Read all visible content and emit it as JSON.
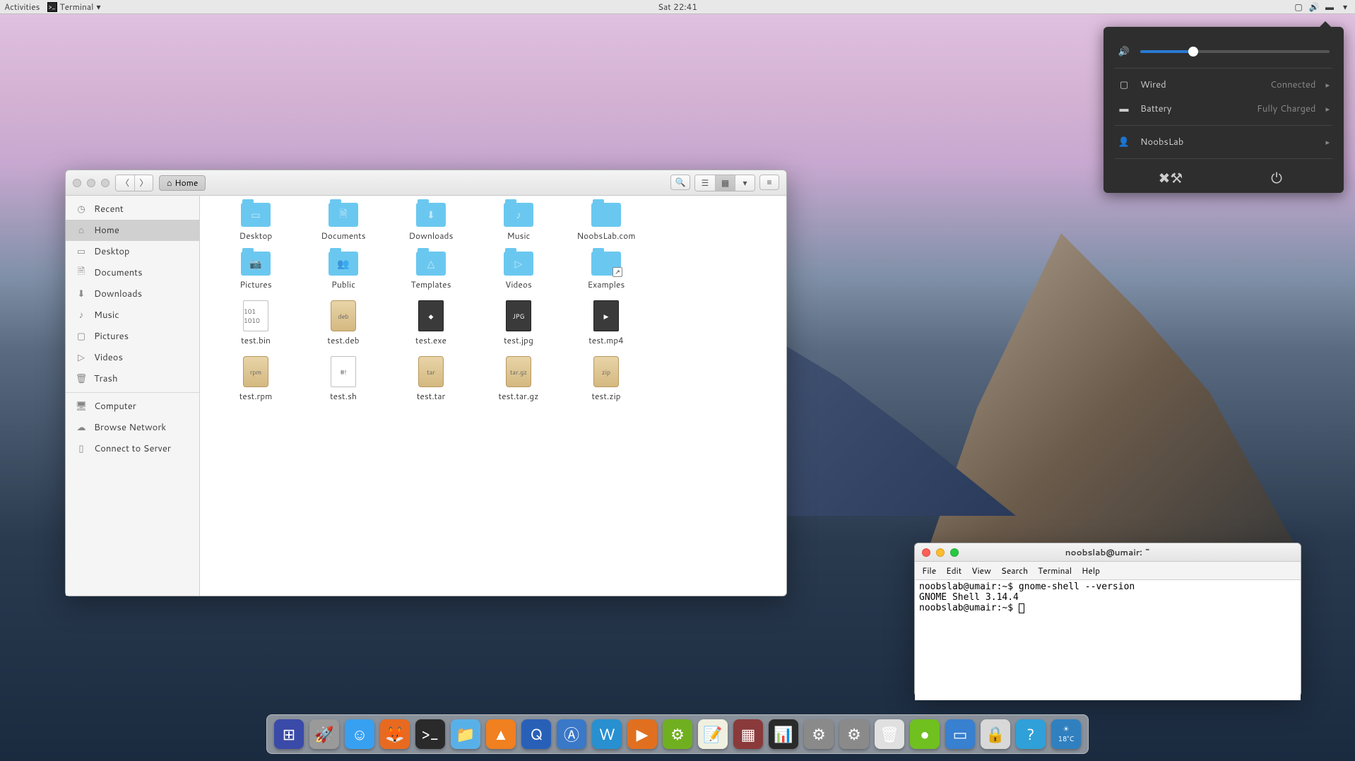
{
  "topbar": {
    "activities": "Activities",
    "app_name": "Terminal",
    "clock": "Sat 22:41"
  },
  "status_popover": {
    "volume_pct": 28,
    "network": {
      "label": "Wired",
      "status": "Connected"
    },
    "battery": {
      "label": "Battery",
      "status": "Fully Charged"
    },
    "user": "NoobsLab"
  },
  "file_manager": {
    "location": "Home",
    "sidebar": [
      {
        "label": "Recent",
        "icon": "clock-icon"
      },
      {
        "label": "Home",
        "icon": "home-icon",
        "active": true
      },
      {
        "label": "Desktop",
        "icon": "desktop-icon"
      },
      {
        "label": "Documents",
        "icon": "documents-icon"
      },
      {
        "label": "Downloads",
        "icon": "downloads-icon"
      },
      {
        "label": "Music",
        "icon": "music-icon"
      },
      {
        "label": "Pictures",
        "icon": "pictures-icon"
      },
      {
        "label": "Videos",
        "icon": "videos-icon"
      },
      {
        "label": "Trash",
        "icon": "trash-icon"
      },
      {
        "label": "Computer",
        "icon": "computer-icon"
      },
      {
        "label": "Browse Network",
        "icon": "network-icon"
      },
      {
        "label": "Connect to Server",
        "icon": "server-icon"
      }
    ],
    "items": [
      {
        "name": "Desktop",
        "type": "folder"
      },
      {
        "name": "Documents",
        "type": "folder"
      },
      {
        "name": "Downloads",
        "type": "folder"
      },
      {
        "name": "Music",
        "type": "folder"
      },
      {
        "name": "NoobsLab.com",
        "type": "folder"
      },
      {
        "name": "Pictures",
        "type": "folder"
      },
      {
        "name": "Public",
        "type": "folder"
      },
      {
        "name": "Templates",
        "type": "folder"
      },
      {
        "name": "Videos",
        "type": "folder"
      },
      {
        "name": "Examples",
        "type": "folder",
        "link": true
      },
      {
        "name": "test.bin",
        "type": "bin"
      },
      {
        "name": "test.deb",
        "type": "deb"
      },
      {
        "name": "test.exe",
        "type": "exe"
      },
      {
        "name": "test.jpg",
        "type": "jpg"
      },
      {
        "name": "test.mp4",
        "type": "mp4"
      },
      {
        "name": "test.rpm",
        "type": "rpm"
      },
      {
        "name": "test.sh",
        "type": "sh"
      },
      {
        "name": "test.tar",
        "type": "tar"
      },
      {
        "name": "test.tar.gz",
        "type": "targz"
      },
      {
        "name": "test.zip",
        "type": "zip"
      }
    ]
  },
  "terminal": {
    "title": "noobslab@umair: ~",
    "menu": [
      "File",
      "Edit",
      "View",
      "Search",
      "Terminal",
      "Help"
    ],
    "lines": [
      "noobslab@umair:~$ gnome-shell --version",
      "GNOME Shell 3.14.4",
      "noobslab@umair:~$ "
    ]
  },
  "dock": {
    "items": [
      {
        "name": "show-apps",
        "color": "#3a4aa8"
      },
      {
        "name": "launcher",
        "color": "#9a9a9a"
      },
      {
        "name": "finder",
        "color": "#38a0f0"
      },
      {
        "name": "firefox",
        "color": "#e86a20"
      },
      {
        "name": "terminal",
        "color": "#2a2a2a"
      },
      {
        "name": "files",
        "color": "#58b0e8"
      },
      {
        "name": "vlc",
        "color": "#f08020"
      },
      {
        "name": "media-player",
        "color": "#2860b8"
      },
      {
        "name": "app-store",
        "color": "#3a78c8"
      },
      {
        "name": "writer",
        "color": "#2890d0"
      },
      {
        "name": "impress",
        "color": "#e07020"
      },
      {
        "name": "software-center",
        "color": "#70b020"
      },
      {
        "name": "notes",
        "color": "#f0f0e0"
      },
      {
        "name": "photos",
        "color": "#8a3a3a"
      },
      {
        "name": "system-monitor",
        "color": "#2a2a2a"
      },
      {
        "name": "gear",
        "color": "#8a8a8a"
      },
      {
        "name": "settings",
        "color": "#8a8a8a"
      },
      {
        "name": "trash",
        "color": "#e0e0e0"
      },
      {
        "name": "disk",
        "color": "#70c020"
      },
      {
        "name": "display",
        "color": "#3880d0"
      },
      {
        "name": "lock",
        "color": "#d8d8d8"
      },
      {
        "name": "help",
        "color": "#30a0d8"
      }
    ],
    "weather_temp": "18°C"
  }
}
